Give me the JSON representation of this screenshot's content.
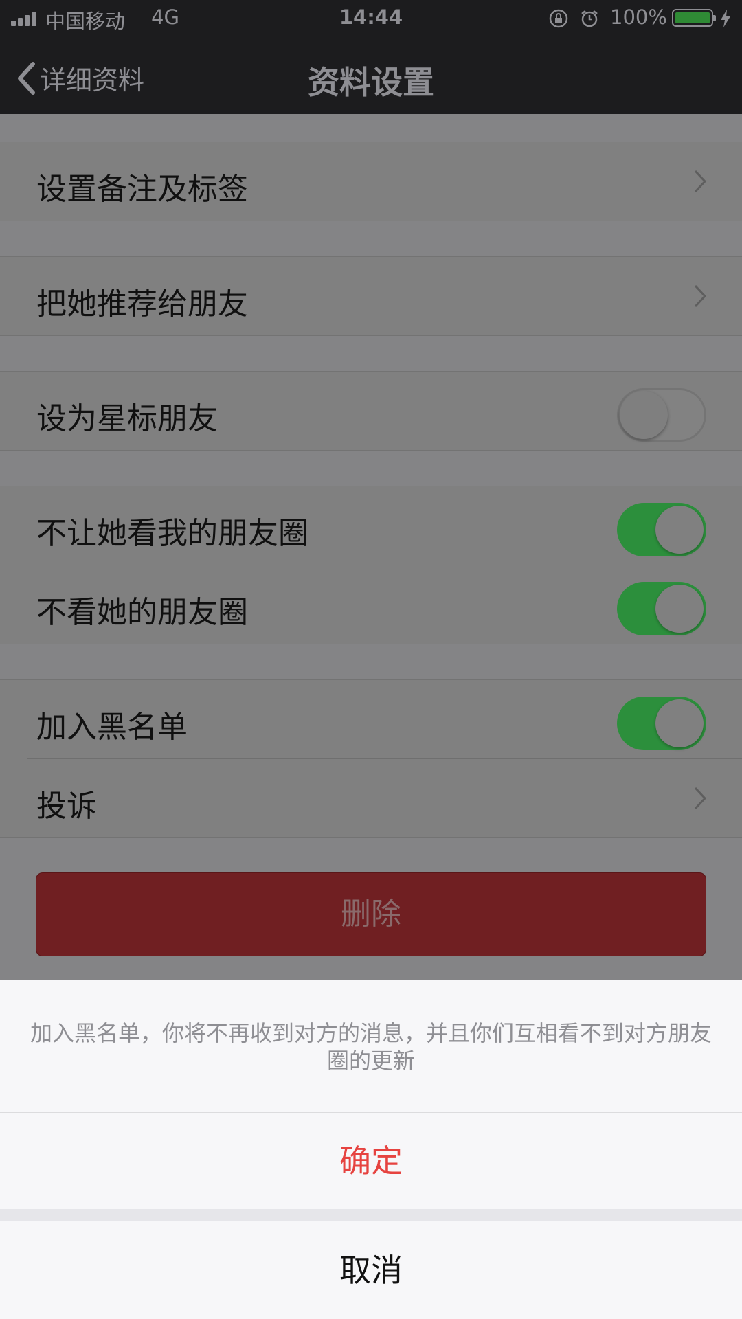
{
  "status_bar": {
    "carrier": "中国移动",
    "network": "4G",
    "time": "14:44",
    "battery": "100%"
  },
  "nav": {
    "back_label": "详细资料",
    "title": "资料设置"
  },
  "settings": {
    "remark": "设置备注及标签",
    "recommend": "把她推荐给朋友",
    "star": {
      "label": "设为星标朋友",
      "on": false
    },
    "hide_moments": {
      "label": "不让她看我的朋友圈",
      "on": true
    },
    "not_view": {
      "label": "不看她的朋友圈",
      "on": true
    },
    "blacklist": {
      "label": "加入黑名单",
      "on": true
    },
    "report": "投诉"
  },
  "delete_label": "删除",
  "action_sheet": {
    "message": "加入黑名单，你将不再收到对方的消息，并且你们互相看不到对方朋友圈的更新",
    "confirm": "确定",
    "cancel": "取消"
  },
  "colors": {
    "accent_green": "#2c8f3c",
    "destructive_red": "#e64340",
    "delete_button": "#701f22"
  }
}
